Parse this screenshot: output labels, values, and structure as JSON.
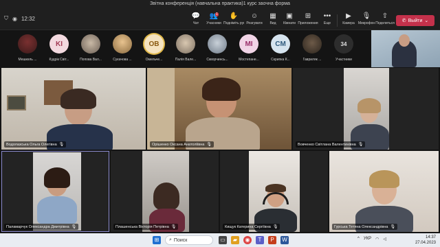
{
  "window": {
    "title": "Звітна конференція (навчальна практика)1 курс заочна форма"
  },
  "toolbar": {
    "time": "12:32",
    "items": [
      {
        "icon": "chat-icon",
        "glyph": "💬",
        "label": "Чат"
      },
      {
        "icon": "participants-icon",
        "glyph": "👥",
        "label": "Учасники",
        "badge": "1"
      },
      {
        "icon": "raise-hand-icon",
        "glyph": "✋",
        "label": "Подніміть руку"
      },
      {
        "icon": "react-icon",
        "glyph": "☺",
        "label": "Реагувати"
      },
      {
        "icon": "view-icon",
        "glyph": "▦",
        "label": "Вид"
      },
      {
        "icon": "rooms-icon",
        "glyph": "▣",
        "label": "Кімнати"
      },
      {
        "icon": "apps-icon",
        "glyph": "⊞",
        "label": "Приложения"
      },
      {
        "icon": "more-icon",
        "glyph": "•••",
        "label": "Еще"
      },
      {
        "icon": "camera-icon",
        "glyph": "▶",
        "label": "Камера"
      },
      {
        "icon": "mic-icon",
        "glyph": "🎙",
        "label": "Микрофон"
      },
      {
        "icon": "share-icon",
        "glyph": "⇧",
        "label": "Поделиться"
      }
    ],
    "leave_label": "Выйти"
  },
  "strip": {
    "participants": [
      {
        "name": "Мешкель ...",
        "initials": "",
        "style": "photo1"
      },
      {
        "name": "Кудрік Світ...",
        "initials": "KI",
        "bg": "#f3d9df",
        "fg": "#a33b55"
      },
      {
        "name": "Попова Вал...",
        "initials": "",
        "style": "photo2"
      },
      {
        "name": "Сукачова ...",
        "initials": "",
        "style": "photo3"
      },
      {
        "name": "Омельче...",
        "initials": "ОВ",
        "bg": "#f5e3c0",
        "fg": "#8a5a10",
        "ring": true
      },
      {
        "name": "Палія Вале...",
        "initials": "",
        "style": "photo4"
      },
      {
        "name": "Скворчинсь...",
        "initials": "",
        "style": "photo5"
      },
      {
        "name": "Мостепане...",
        "initials": "MI",
        "bg": "#f1d4e6",
        "fg": "#9a2f6a"
      },
      {
        "name": "Скрипка К...",
        "initials": "CM",
        "bg": "#d6e4ef",
        "fg": "#2f5a7d"
      },
      {
        "name": "Гавриляк ...",
        "initials": "",
        "style": "photo6"
      }
    ],
    "more_count": "34",
    "more_label": "Участники"
  },
  "tiles": [
    {
      "name": "Водолазська Ольга Олегівна"
    },
    {
      "name": "Орішенко Оксана Анатоліївна"
    },
    {
      "name": "Вовченко Світлана Валентинівна"
    },
    {
      "name": "Паламарчук Олександра Дмитрівна"
    },
    {
      "name": "Плашенська Вікторія Петрівна"
    },
    {
      "name": "Кищук Катерина Сергіївна"
    },
    {
      "name": "Гурська Тетяна Олександрівна"
    }
  ],
  "taskbar": {
    "search_placeholder": "Поиск",
    "lang": "УКР",
    "time": "14:37",
    "date": "27.04.2023"
  }
}
